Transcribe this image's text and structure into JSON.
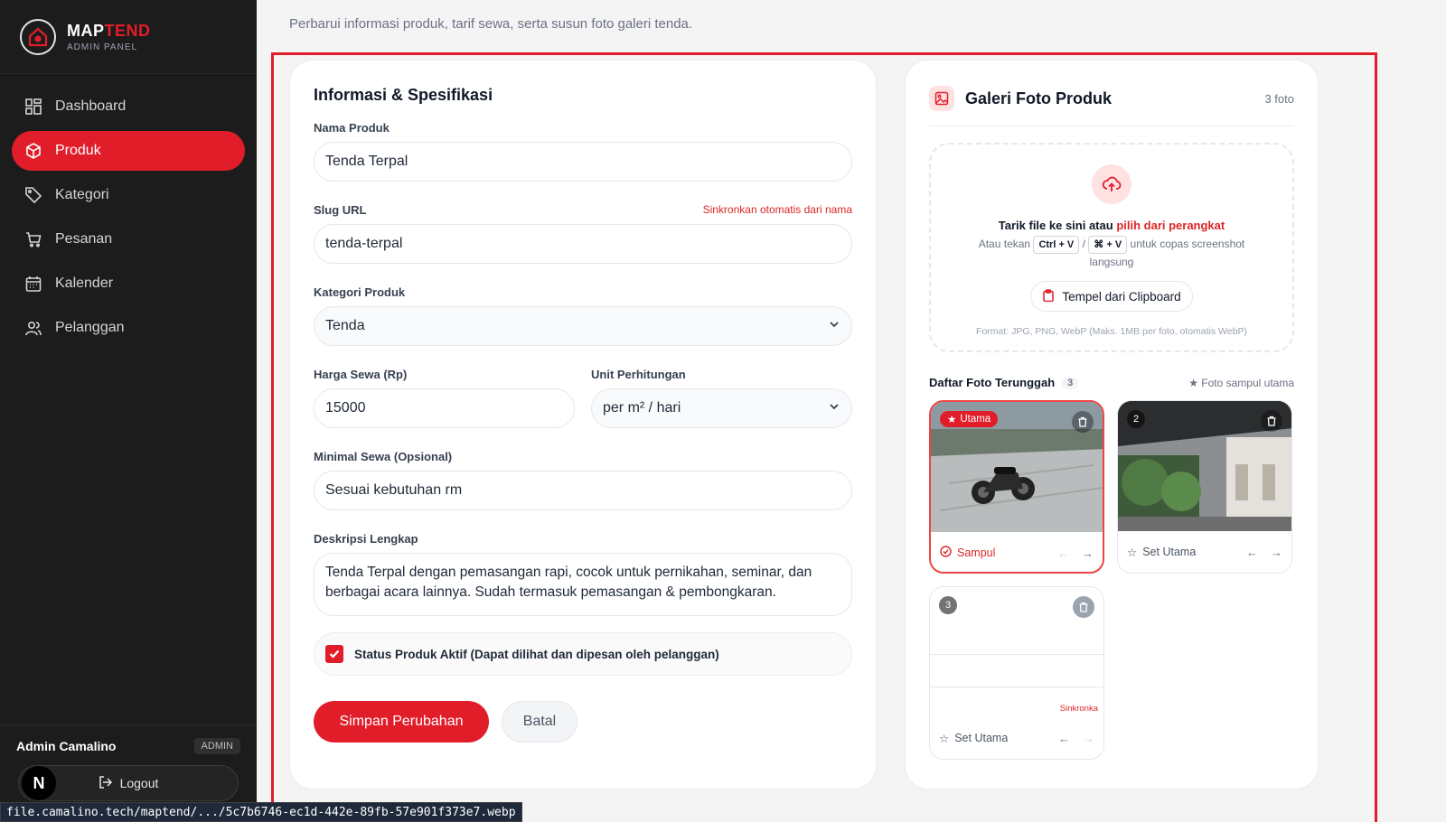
{
  "brand": {
    "name_part1": "MAP",
    "name_part2": "TEND",
    "subtitle": "ADMIN PANEL"
  },
  "nav": [
    {
      "label": "Dashboard",
      "icon": "dashboard-icon",
      "active": false
    },
    {
      "label": "Produk",
      "icon": "box-icon",
      "active": true
    },
    {
      "label": "Kategori",
      "icon": "tag-icon",
      "active": false
    },
    {
      "label": "Pesanan",
      "icon": "cart-icon",
      "active": false
    },
    {
      "label": "Kalender",
      "icon": "calendar-icon",
      "active": false
    },
    {
      "label": "Pelanggan",
      "icon": "users-icon",
      "active": false
    }
  ],
  "user": {
    "name": "Admin Camalino",
    "role": "ADMIN",
    "avatar": "N",
    "logout_label": "Logout"
  },
  "page": {
    "subtitle": "Perbarui informasi produk, tarif sewa, serta susun foto galeri tenda."
  },
  "form": {
    "title": "Informasi & Spesifikasi",
    "name_label": "Nama Produk",
    "name_value": "Tenda Terpal",
    "slug_label": "Slug URL",
    "slug_sync": "Sinkronkan otomatis dari nama",
    "slug_value": "tenda-terpal",
    "category_label": "Kategori Produk",
    "category_value": "Tenda",
    "price_label": "Harga Sewa (Rp)",
    "price_value": "15000",
    "unit_label": "Unit Perhitungan",
    "unit_value": "per m² / hari",
    "min_label": "Minimal Sewa (Opsional)",
    "min_value": "Sesuai kebutuhan rm",
    "desc_label": "Deskripsi Lengkap",
    "desc_value": "Tenda Terpal dengan pemasangan rapi, cocok untuk pernikahan, seminar, dan berbagai acara lainnya. Sudah termasuk pemasangan & pembongkaran.",
    "status_label": "Status Produk Aktif (Dapat dilihat dan dipesan oleh pelanggan)",
    "status_checked": true,
    "save_label": "Simpan Perubahan",
    "cancel_label": "Batal"
  },
  "gallery": {
    "title": "Galeri Foto Produk",
    "count": "3 foto",
    "drop_text": "Tarik file ke sini atau ",
    "drop_link": "pilih dari perangkat",
    "hint_prefix": "Atau tekan",
    "kbd1": "Ctrl + V",
    "kbd_sep": "/",
    "kbd2": "⌘ + V",
    "hint_suffix": "untuk copas screenshot langsung",
    "paste_label": "Tempel dari Clipboard",
    "format_hint": "Format: JPG, PNG, WebP (Maks. 1MB per foto, otomatis WebP)",
    "list_title": "Daftar Foto Terunggah",
    "list_count": "3",
    "cover_hint": "★ Foto sampul utama",
    "photos": [
      {
        "badge": "Utama",
        "footer": "Sampul",
        "is_cover": true
      },
      {
        "badge": "2",
        "footer": "Set Utama",
        "is_cover": false
      },
      {
        "badge": "3",
        "footer": "Set Utama",
        "is_cover": false,
        "sync_tag": "Sinkronka"
      }
    ]
  },
  "statusbar": {
    "url": "file.camalino.tech/maptend/.../5c7b6746-ec1d-442e-89fb-57e901f373e7.webp"
  },
  "colors": {
    "accent": "#e11d2a",
    "sidebar": "#1c1c1c"
  }
}
